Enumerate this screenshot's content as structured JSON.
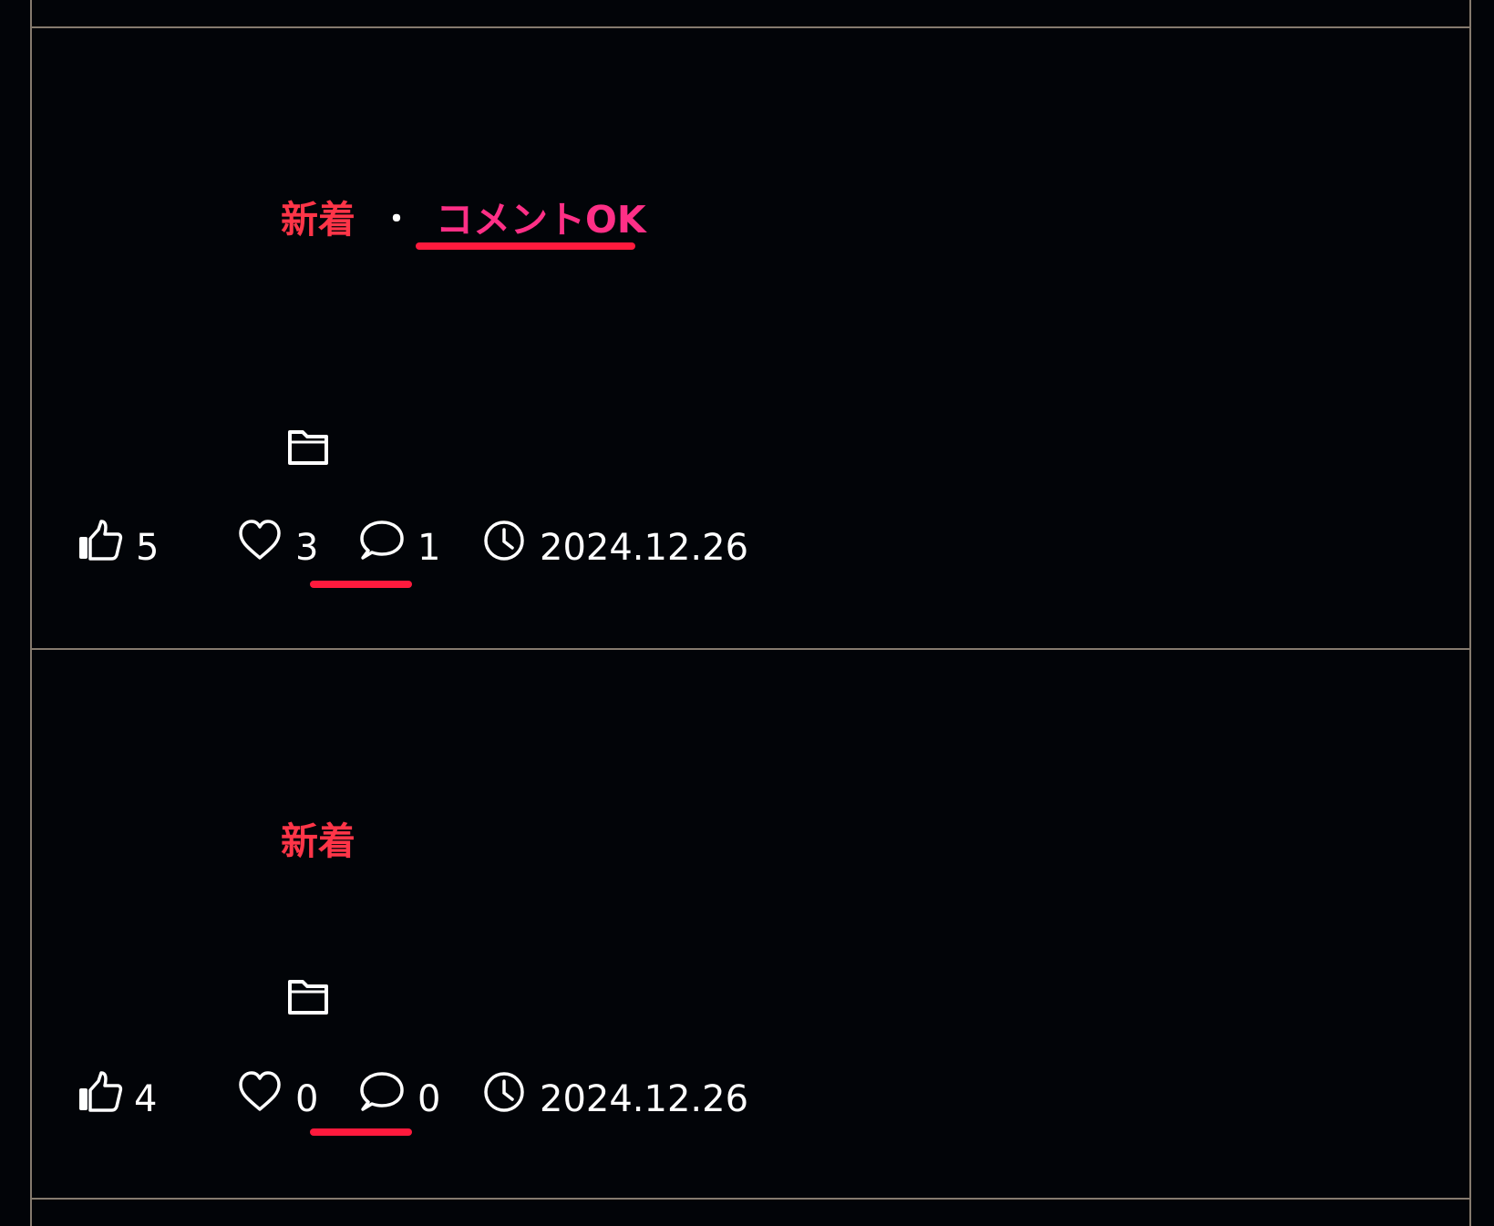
{
  "posts": [
    {
      "tag_new": "新着",
      "tag_separator": "・",
      "tag_comment": "コメントOK",
      "likes": "5",
      "favorites": "3",
      "comments": "1",
      "date": "2024.12.26"
    },
    {
      "tag_new": "新着",
      "likes": "4",
      "favorites": "0",
      "comments": "0",
      "date": "2024.12.26"
    }
  ],
  "colors": {
    "background": "#020408",
    "divider": "#857a6e",
    "tag_new": "#ff3548",
    "tag_comment": "#ff2f86",
    "highlight_underline": "#ff1a3d",
    "text": "#ffffff"
  },
  "icons": [
    "thumbs-up-icon",
    "heart-icon",
    "comment-icon",
    "clock-icon",
    "folder-icon"
  ]
}
